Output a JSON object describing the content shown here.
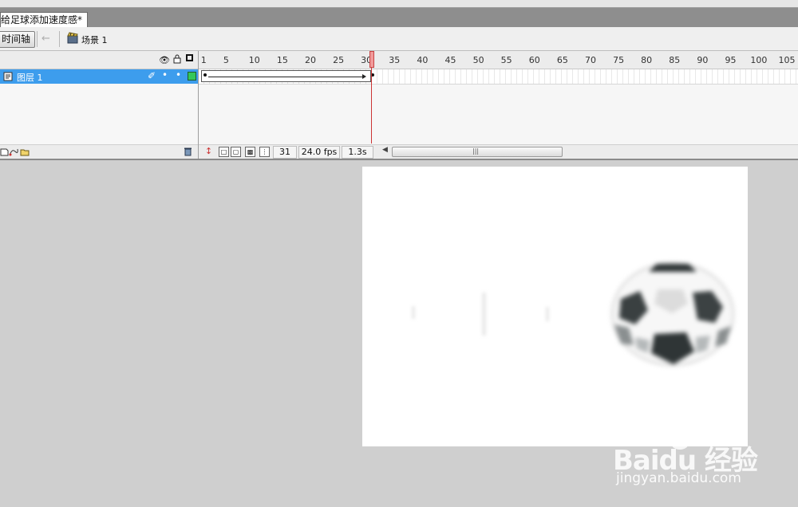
{
  "document": {
    "tab_title": "给足球添加速度感*"
  },
  "toolbar": {
    "timeline_button": "时间轴",
    "scene_label": "场景 1"
  },
  "layers": {
    "items": [
      {
        "name": "图层 1"
      }
    ]
  },
  "timeline": {
    "ruler_ticks": [
      "1",
      "5",
      "10",
      "15",
      "20",
      "25",
      "30",
      "35",
      "40",
      "45",
      "50",
      "55",
      "60",
      "65",
      "70",
      "75",
      "80",
      "85",
      "90",
      "95",
      "100",
      "105"
    ],
    "current_frame": "31",
    "frame_rate": "24.0 fps",
    "elapsed_time": "1.3s"
  },
  "watermark": {
    "brand": "Baidu 经验",
    "url": "jingyan.baidu.com"
  },
  "colors": {
    "layer_selected": "#3d9ded",
    "playhead": "#cc3333",
    "stage_bg": "#cfcfcf",
    "canvas_bg": "#ffffff"
  }
}
